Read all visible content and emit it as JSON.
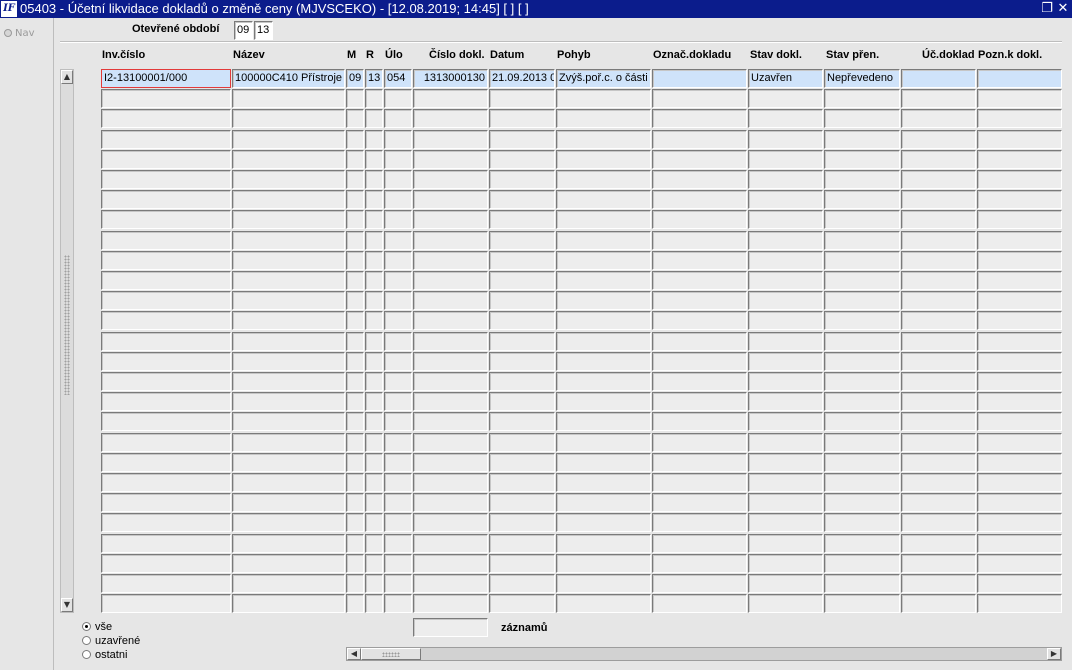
{
  "window": {
    "icon": "IF",
    "title": "05403 - Účetní likvidace dokladů o změně ceny (MJVSCEKO) - [12.08.2019; 14:45]  [ ]  [ ]",
    "restore_glyph": "❐",
    "close_glyph": "✕"
  },
  "nav": {
    "label": "Nav"
  },
  "period": {
    "label": "Otevřené období",
    "month": "09",
    "year": "13"
  },
  "columns": [
    "Inv.číslo",
    "Název",
    "M",
    "R",
    "Úlo",
    "Číslo dokl.",
    "Datum",
    "Pohyb",
    "Označ.dokladu",
    "Stav dokl.",
    "Stav přen.",
    "Úč.doklad",
    "Pozn.k dokl."
  ],
  "rows": [
    [
      "I2-13100001/000",
      "100000C410 Přístroje",
      "09",
      "13",
      "054",
      "1313000130",
      "21.09.2013 0",
      "Zvýš.poř.c. o části",
      "",
      "Uzavřen",
      "Nepřevedeno",
      "",
      ""
    ]
  ],
  "visible_row_count": 27,
  "footer": {
    "filter_options": [
      "vše",
      "uzavřené",
      "ostatni"
    ],
    "selected_filter": 0,
    "records_count": "",
    "records_label": "záznamů"
  },
  "colors": {
    "title_bar": "#0b1c8c",
    "selected_row": "#cfe3fa",
    "focus_border": "#e23a3a",
    "background": "#e6e6e6"
  },
  "icons": {
    "app": "app-logo-icon",
    "restore": "restore-window-icon",
    "close": "close-icon",
    "scroll_up": "scroll-up-icon",
    "scroll_down": "scroll-down-icon",
    "scroll_left": "scroll-left-icon",
    "scroll_right": "scroll-right-icon"
  }
}
